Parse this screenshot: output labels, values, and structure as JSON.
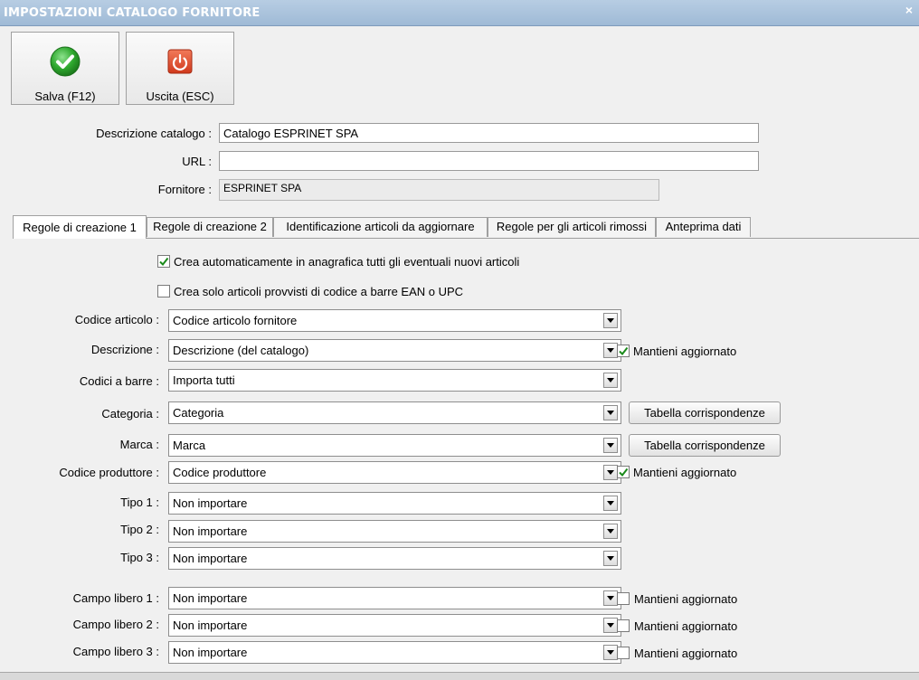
{
  "window": {
    "title": "IMPOSTAZIONI CATALOGO FORNITORE",
    "close_glyph": "×"
  },
  "toolbar": {
    "save": {
      "label": "Salva (F12)",
      "icon": "check-icon",
      "color": "#2ea82e"
    },
    "exit": {
      "label": "Uscita (ESC)",
      "icon": "power-icon",
      "color": "#e04a2a"
    }
  },
  "form": {
    "descrizione": {
      "label": "Descrizione catalogo :",
      "value": "Catalogo ESPRINET SPA"
    },
    "url": {
      "label": "URL :",
      "value": ""
    },
    "fornitore": {
      "label": "Fornitore :",
      "value": "ESPRINET SPA"
    }
  },
  "tabs": [
    {
      "label": "Regole di creazione 1",
      "active": true
    },
    {
      "label": "Regole di creazione 2"
    },
    {
      "label": "Identificazione articoli da aggiornare"
    },
    {
      "label": "Regole per gli articoli rimossi"
    },
    {
      "label": "Anteprima dati"
    }
  ],
  "options": {
    "crea_auto": {
      "label": "Crea automaticamente in anagrafica tutti gli eventuali nuovi articoli",
      "checked": true
    },
    "crea_ean": {
      "label": "Crea solo articoli provvisti di codice a barre EAN o UPC",
      "checked": false
    }
  },
  "rows": [
    {
      "label": "Codice articolo :",
      "value": "Codice articolo fornitore"
    },
    {
      "label": "Descrizione :",
      "value": "Descrizione (del catalogo)",
      "keep": {
        "label": "Mantieni aggiornato",
        "checked": true
      }
    },
    {
      "label": "Codici a barre :",
      "value": "Importa tutti"
    },
    {
      "label": "Categoria :",
      "value": "Categoria",
      "button": "Tabella corrispondenze"
    },
    {
      "label": "Marca :",
      "value": "Marca",
      "button": "Tabella corrispondenze"
    },
    {
      "label": "Codice produttore :",
      "value": "Codice produttore",
      "keep": {
        "label": "Mantieni aggiornato",
        "checked": true
      }
    },
    {
      "label": "Tipo 1 :",
      "value": "Non importare"
    },
    {
      "label": "Tipo 2 :",
      "value": "Non importare"
    },
    {
      "label": "Tipo 3 :",
      "value": "Non importare"
    },
    {
      "label": "Campo libero 1 :",
      "value": "Non importare",
      "keep": {
        "label": "Mantieni aggiornato",
        "checked": false
      }
    },
    {
      "label": "Campo libero 2 :",
      "value": "Non importare",
      "keep": {
        "label": "Mantieni aggiornato",
        "checked": false
      }
    },
    {
      "label": "Campo libero 3 :",
      "value": "Non importare",
      "keep": {
        "label": "Mantieni aggiornato",
        "checked": false
      }
    }
  ]
}
